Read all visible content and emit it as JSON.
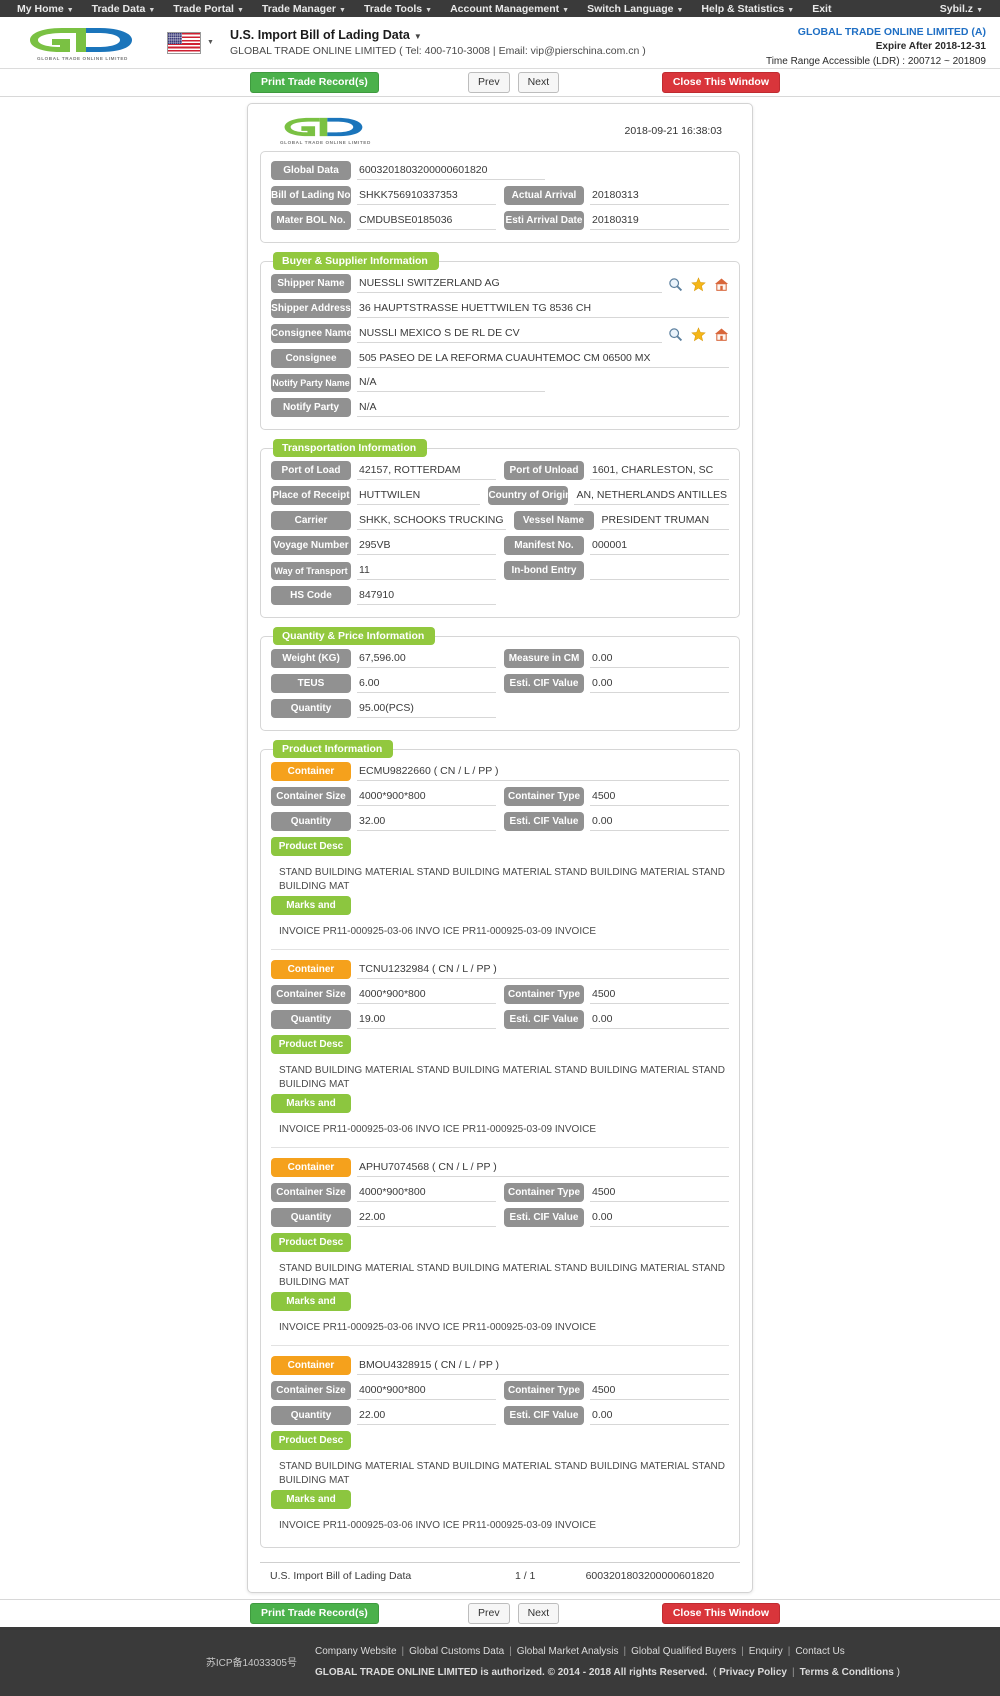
{
  "topnav": {
    "items": [
      {
        "label": "My Home",
        "caret": true
      },
      {
        "label": "Trade Data",
        "caret": true
      },
      {
        "label": "Trade Portal",
        "caret": true
      },
      {
        "label": "Trade Manager",
        "caret": true
      },
      {
        "label": "Trade Tools",
        "caret": true
      },
      {
        "label": "Account Management",
        "caret": true
      },
      {
        "label": "Switch Language",
        "caret": true
      },
      {
        "label": "Help & Statistics",
        "caret": true
      },
      {
        "label": "Exit",
        "caret": false
      }
    ],
    "user": "Sybil.z"
  },
  "header": {
    "logo_text": "GTC",
    "logo_sub": "GLOBAL TRADE ONLINE LIMITED",
    "flag": "us-flag-icon",
    "title": "U.S. Import Bill of Lading Data",
    "subtitle": "GLOBAL TRADE ONLINE LIMITED ( Tel: 400-710-3008 | Email: vip@pierschina.com.cn )",
    "account_name": "GLOBAL TRADE ONLINE LIMITED (A)",
    "expire": "Expire After 2018-12-31",
    "time_range": "Time Range Accessible (LDR) : 200712 ~ 201809"
  },
  "toolbar": {
    "print_label": "Print Trade Record(s)",
    "prev_label": "Prev",
    "next_label": "Next",
    "close_label": "Close This Window"
  },
  "document": {
    "timestamp": "2018-09-21 16:38:03",
    "identity": {
      "global_data_label": "Global Data",
      "global_data_value": "6003201803200000601820",
      "bol_label": "Bill of Lading No.",
      "bol_value": "SHKK756910337353",
      "actual_arrival_label": "Actual Arrival",
      "actual_arrival_value": "20180313",
      "master_bol_label": "Mater BOL No.",
      "master_bol_value": "CMDUBSE0185036",
      "esti_arrival_label": "Esti Arrival Date",
      "esti_arrival_value": "20180319"
    },
    "buyer_supplier": {
      "legend": "Buyer & Supplier Information",
      "shipper_name_label": "Shipper Name",
      "shipper_name_value": "NUESSLI SWITZERLAND AG",
      "shipper_address_label": "Shipper Address",
      "shipper_address_value": "36 HAUPTSTRASSE HUETTWILEN TG 8536 CH",
      "consignee_name_label": "Consignee Name",
      "consignee_name_value": "NUSSLI MEXICO S DE RL DE CV",
      "consignee_label": "Consignee",
      "consignee_value": "505 PASEO DE LA REFORMA CUAUHTEMOC CM 06500 MX",
      "notify_party_name_label": "Notify Party Name",
      "notify_party_name_value": "N/A",
      "notify_party_label": "Notify Party",
      "notify_party_value": "N/A"
    },
    "transportation": {
      "legend": "Transportation Information",
      "port_of_load_label": "Port of Load",
      "port_of_load_value": "42157, ROTTERDAM",
      "port_of_unload_label": "Port of Unload",
      "port_of_unload_value": "1601, CHARLESTON, SC",
      "place_of_receipt_label": "Place of Receipt",
      "place_of_receipt_value": "HUTTWILEN",
      "country_of_origin_label": "Country of Origin",
      "country_of_origin_value": "AN, NETHERLANDS ANTILLES",
      "carrier_label": "Carrier",
      "carrier_value": "SHKK, SCHOOKS TRUCKING",
      "vessel_name_label": "Vessel Name",
      "vessel_name_value": "PRESIDENT TRUMAN",
      "voyage_number_label": "Voyage Number",
      "voyage_number_value": "295VB",
      "manifest_no_label": "Manifest No.",
      "manifest_no_value": "000001",
      "way_of_transport_label": "Way of Transport",
      "way_of_transport_value": "11",
      "inbond_entry_label": "In-bond Entry",
      "inbond_entry_value": "",
      "hs_code_label": "HS Code",
      "hs_code_value": "847910"
    },
    "quantity_price": {
      "legend": "Quantity & Price Information",
      "weight_label": "Weight (KG)",
      "weight_value": "67,596.00",
      "measure_label": "Measure in CM",
      "measure_value": "0.00",
      "teus_label": "TEUS",
      "teus_value": "6.00",
      "cif_label": "Esti. CIF Value",
      "cif_value": "0.00",
      "quantity_label": "Quantity",
      "quantity_value": "95.00(PCS)"
    },
    "product": {
      "legend": "Product Information",
      "container_label": "Container",
      "container_size_label": "Container Size",
      "container_type_label": "Container Type",
      "quantity_label": "Quantity",
      "cif_label": "Esti. CIF Value",
      "product_desc_label": "Product Desc",
      "marks_label": "Marks and",
      "items": [
        {
          "container": "ECMU9822660 ( CN / L / PP )",
          "size": "4000*900*800",
          "type": "4500",
          "quantity": "32.00",
          "cif": "0.00",
          "desc": "STAND BUILDING MATERIAL STAND BUILDING MATERIAL STAND BUILDING MATERIAL STAND BUILDING MAT",
          "marks": "INVOICE PR11-000925-03-06 INVO ICE PR11-000925-03-09 INVOICE"
        },
        {
          "container": "TCNU1232984 ( CN / L / PP )",
          "size": "4000*900*800",
          "type": "4500",
          "quantity": "19.00",
          "cif": "0.00",
          "desc": "STAND BUILDING MATERIAL STAND BUILDING MATERIAL STAND BUILDING MATERIAL STAND BUILDING MAT",
          "marks": "INVOICE PR11-000925-03-06 INVO ICE PR11-000925-03-09 INVOICE"
        },
        {
          "container": "APHU7074568 ( CN / L / PP )",
          "size": "4000*900*800",
          "type": "4500",
          "quantity": "22.00",
          "cif": "0.00",
          "desc": "STAND BUILDING MATERIAL STAND BUILDING MATERIAL STAND BUILDING MATERIAL STAND BUILDING MAT",
          "marks": "INVOICE PR11-000925-03-06 INVO ICE PR11-000925-03-09 INVOICE"
        },
        {
          "container": "BMOU4328915 ( CN / L / PP )",
          "size": "4000*900*800",
          "type": "4500",
          "quantity": "22.00",
          "cif": "0.00",
          "desc": "STAND BUILDING MATERIAL STAND BUILDING MATERIAL STAND BUILDING MATERIAL STAND BUILDING MAT",
          "marks": "INVOICE PR11-000925-03-06 INVO ICE PR11-000925-03-09 INVOICE"
        }
      ]
    },
    "footer": {
      "title": "U.S. Import Bill of Lading Data",
      "page": "1 / 1",
      "record_id": "6003201803200000601820"
    }
  },
  "sitefooter": {
    "icp": "苏ICP备14033305号",
    "links": [
      "Company Website",
      "Global Customs Data",
      "Global Market Analysis",
      "Global Qualified Buyers",
      "Enquiry",
      "Contact Us"
    ],
    "copyright": "GLOBAL TRADE ONLINE LIMITED is authorized. © 2014 - 2018 All rights Reserved.",
    "privacy": "Privacy Policy",
    "terms": "Terms & Conditions"
  },
  "colors": {
    "green": "#8cc63f",
    "legend_green": "#92c83e",
    "grey_label": "#919191",
    "orange": "#f5a11c",
    "accent_blue": "#1f6fc4",
    "danger_red": "#d9353b",
    "nav_dark": "#3a3a3a"
  }
}
